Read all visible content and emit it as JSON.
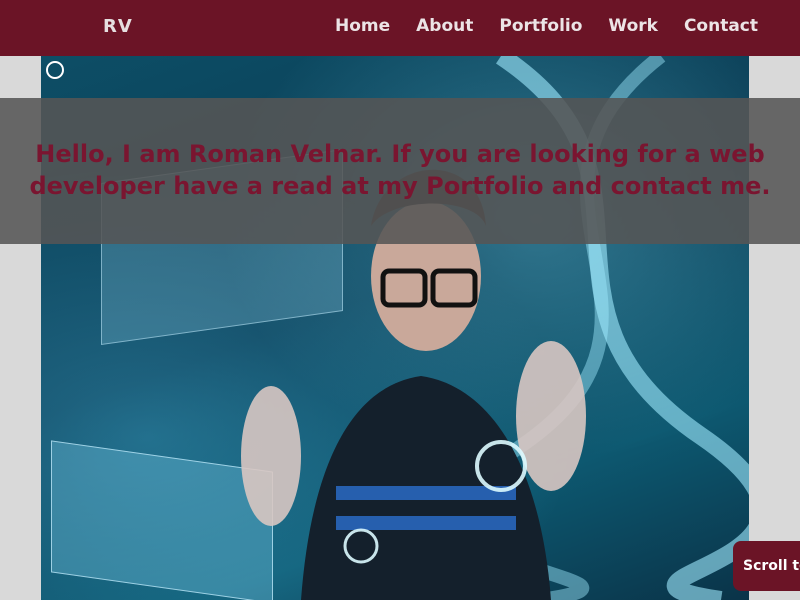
{
  "navbar": {
    "brand": "RV",
    "links": [
      "Home",
      "About",
      "Portfolio",
      "Work",
      "Contact"
    ]
  },
  "hero": {
    "headline_line1": "Hello, I am Roman Velnar. If you are looking for a web",
    "headline_line2": "developer have a read at my Portfolio and contact me."
  },
  "scroll_button": {
    "label": "Scroll to the"
  },
  "colors": {
    "navbar_bg": "#6b1426",
    "headline_text": "#7a1530",
    "overlay_band": "#555555",
    "page_bg": "#d9d9d9"
  }
}
